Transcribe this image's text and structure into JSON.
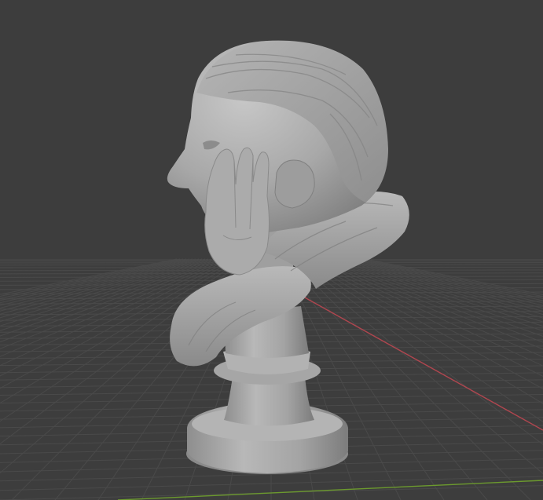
{
  "viewport": {
    "background_color": "#3d3d3d",
    "grid_color": "#4a4a4a",
    "x_axis_color": "#b0464f",
    "y_axis_color": "#6c9a2e",
    "mesh_color": "#a9a9a9"
  },
  "object": {
    "name": "sculpted-bust"
  }
}
